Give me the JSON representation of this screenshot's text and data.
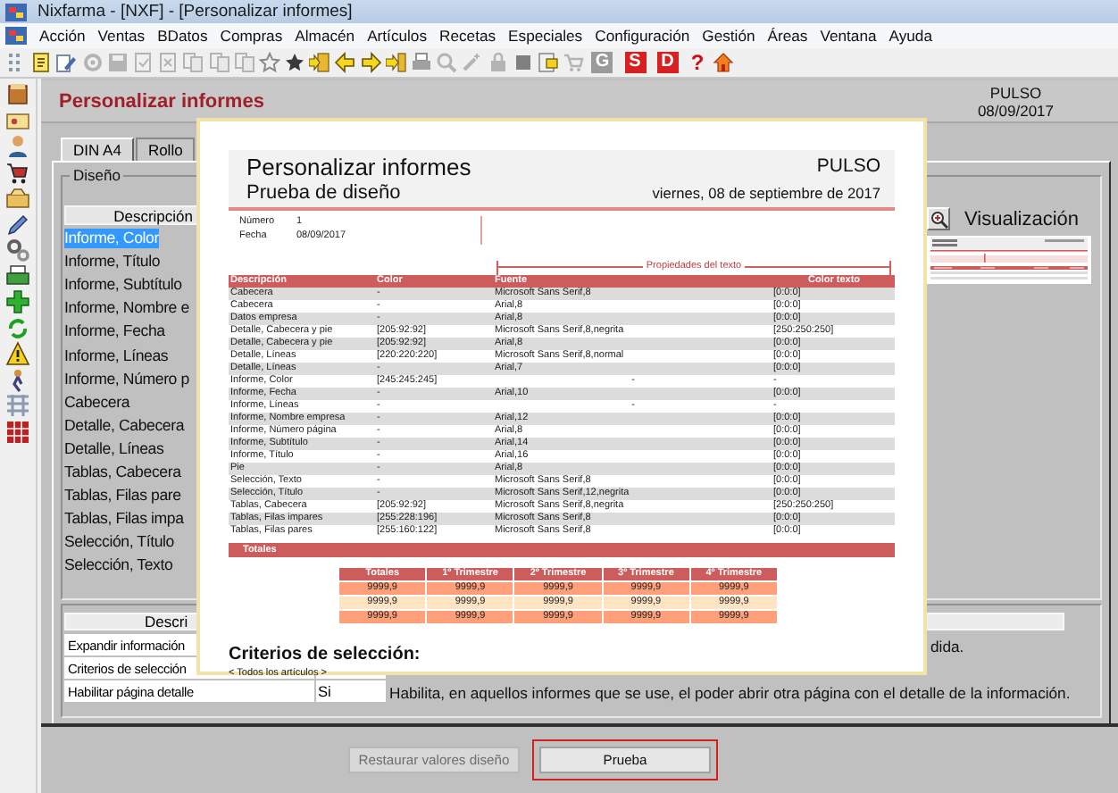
{
  "window": {
    "title": "Nixfarma - [NXF] - [Personalizar informes]"
  },
  "menu": [
    "Acción",
    "Ventas",
    "BDatos",
    "Compras",
    "Almacén",
    "Artículos",
    "Recetas",
    "Especiales",
    "Configuración",
    "Gestión",
    "Áreas",
    "Ventana",
    "Ayuda"
  ],
  "toolbar": {
    "letter_buttons": [
      {
        "label": "G",
        "disabled": true
      },
      {
        "label": "S",
        "disabled": false
      },
      {
        "label": "D",
        "disabled": false
      }
    ],
    "help_button": "?"
  },
  "form": {
    "title": "Personalizar informes",
    "company": "PULSO",
    "date": "08/09/2017",
    "tabs": [
      {
        "label": "DIN A4",
        "selected": true
      },
      {
        "label": "Rollo",
        "selected": false
      }
    ],
    "design_group": {
      "label": "Diseño",
      "column_header": "Descripción",
      "items": [
        {
          "label": "Informe, Color",
          "selected": true
        },
        {
          "label": "Informe, Título",
          "selected": false
        },
        {
          "label": "Informe, Subtítulo",
          "selected": false
        },
        {
          "label": "Informe, Nombre e",
          "selected": false
        },
        {
          "label": "Informe, Fecha",
          "selected": false
        },
        {
          "label": "Informe, Líneas",
          "selected": false
        },
        {
          "label": "Informe, Número p",
          "selected": false
        },
        {
          "label": "Cabecera",
          "selected": false
        },
        {
          "label": "Detalle, Cabecera",
          "selected": false
        },
        {
          "label": "Detalle, Líneas",
          "selected": false
        },
        {
          "label": "Tablas, Cabecera",
          "selected": false
        },
        {
          "label": "Tablas, Filas pare",
          "selected": false
        },
        {
          "label": "Tablas, Filas impa",
          "selected": false
        },
        {
          "label": "Selección, Título",
          "selected": false
        },
        {
          "label": "Selección, Texto",
          "selected": false
        }
      ]
    },
    "preview_label": "Visualización",
    "options_table": {
      "column_header": "Descri",
      "rows": [
        {
          "name": "Expandir información",
          "detail_tail": "dida."
        },
        {
          "name": "Criterios de selección"
        },
        {
          "name": "Habilitar página detalle",
          "value": "Si",
          "detail": "Habilita, en aquellos informes que se use, el poder abrir otra página con el detalle de la información."
        }
      ]
    },
    "buttons": [
      {
        "label": "Restaurar valores diseño",
        "disabled": true,
        "focused": false
      },
      {
        "label": "Prueba",
        "disabled": false,
        "focused": true
      }
    ]
  },
  "report": {
    "title": "Personalizar informes",
    "subtitle": "Prueba de diseño",
    "company": "PULSO",
    "date": "viernes, 08 de septiembre de 2017",
    "fields": [
      {
        "label": "Número",
        "value": "1"
      },
      {
        "label": "Fecha",
        "value": "08/09/2017"
      }
    ],
    "group_label": "Propiedades del texto",
    "columns": [
      "Descripción",
      "Color",
      "Fuente",
      "Color texto"
    ],
    "rows": [
      [
        "Cabecera",
        "-",
        "Microsoft Sans Serif,8",
        "[0:0:0]"
      ],
      [
        "Cabecera",
        "-",
        "Arial,8",
        "[0:0:0]"
      ],
      [
        "Datos empresa",
        "-",
        "Arial,8",
        "[0:0:0]"
      ],
      [
        "Detalle, Cabecera y pie",
        "[205:92:92]",
        "Microsoft Sans Serif,8,negrita",
        "[250:250:250]"
      ],
      [
        "Detalle, Cabecera y pie",
        "[205:92:92]",
        "Arial,8",
        "[0:0:0]"
      ],
      [
        "Detalle, Líneas",
        "[220:220:220]",
        "Microsoft Sans Serif,8,normal",
        "[0:0:0]"
      ],
      [
        "Detalle, Líneas",
        "-",
        "Arial,7",
        "[0:0:0]"
      ],
      [
        "Informe, Color",
        "[245:245:245]",
        "-",
        "-"
      ],
      [
        "Informe, Fecha",
        "-",
        "Arial,10",
        "[0:0:0]"
      ],
      [
        "Informe, Líneas",
        "-",
        "-",
        "-"
      ],
      [
        "Informe, Nombre empresa",
        "-",
        "Arial,12",
        "[0:0:0]"
      ],
      [
        "Informe, Número página",
        "-",
        "Arial,8",
        "[0:0:0]"
      ],
      [
        "Informe, Subtítulo",
        "-",
        "Arial,14",
        "[0:0:0]"
      ],
      [
        "Informe, Título",
        "-",
        "Arial,16",
        "[0:0:0]"
      ],
      [
        "Pie",
        "-",
        "Arial,8",
        "[0:0:0]"
      ],
      [
        "Selección, Texto",
        "-",
        "Microsoft Sans Serif,8",
        "[0:0:0]"
      ],
      [
        "Selección, Título",
        "-",
        "Microsoft Sans Serif,12,negrita",
        "[0:0:0]"
      ],
      [
        "Tablas, Cabecera",
        "[205:92:92]",
        "Microsoft Sans Serif,8,negrita",
        "[250:250:250]"
      ],
      [
        "Tablas, Filas impares",
        "[255:228:196]",
        "Microsoft Sans Serif,8",
        "[0:0:0]"
      ],
      [
        "Tablas, Filas pares",
        "[255:160:122]",
        "Microsoft Sans Serif,8",
        "[0:0:0]"
      ]
    ],
    "totals_label": "Totales",
    "summary": {
      "columns": [
        "Totales",
        "1º Trimestre",
        "2º Trimestre",
        "3º Trimestre",
        "4º Trimestre"
      ],
      "rows": [
        [
          "9999,9",
          "9999,9",
          "9999,9",
          "9999,9",
          "9999,9"
        ],
        [
          "9999,9",
          "9999,9",
          "9999,9",
          "9999,9",
          "9999,9"
        ],
        [
          "9999,9",
          "9999,9",
          "9999,9",
          "9999,9",
          "9999,9"
        ]
      ]
    },
    "criteria_title": "Criterios de selección:",
    "criteria_text": "< Todos los artículos >"
  }
}
